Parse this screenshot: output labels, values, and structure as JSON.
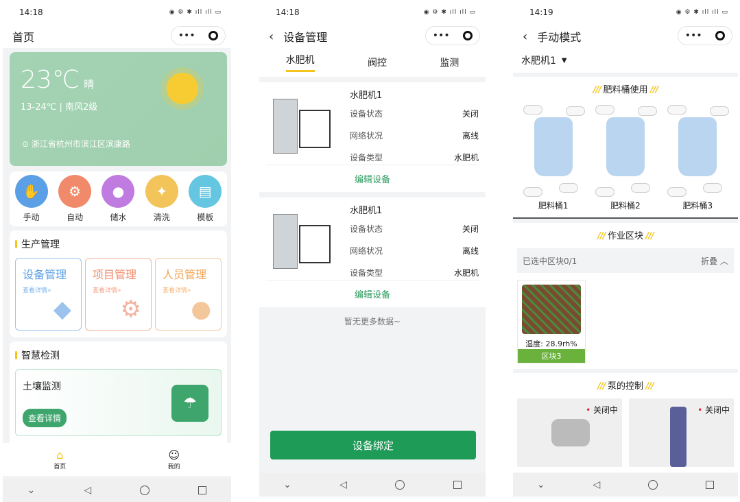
{
  "phone1": {
    "time": "14:18",
    "title": "首页",
    "temp": "23℃",
    "cond": "晴",
    "range": "13-24℃ | 南风2级",
    "location": "浙江省杭州市滨江区滨康路",
    "quick": [
      {
        "label": "手动",
        "color": "#5b9fe6"
      },
      {
        "label": "自动",
        "color": "#f08a6a"
      },
      {
        "label": "储水",
        "color": "#c07be0"
      },
      {
        "label": "清洗",
        "color": "#f2c45a"
      },
      {
        "label": "模板",
        "color": "#64c6e0"
      }
    ],
    "prod_title": "生产管理",
    "modules": [
      {
        "label": "设备管理",
        "sub": "查看详情»",
        "color": "#5b9fe6"
      },
      {
        "label": "项目管理",
        "sub": "查看详情»",
        "color": "#f08a6a"
      },
      {
        "label": "人员管理",
        "sub": "查看详情»",
        "color": "#f2a253"
      }
    ],
    "smart_title": "智慧检测",
    "soil": "土壤监测",
    "soil_btn": "查看详情",
    "tab_home": "首页",
    "tab_me": "我的"
  },
  "phone2": {
    "time": "14:18",
    "title": "设备管理",
    "tabs": [
      "水肥机",
      "阀控",
      "监测"
    ],
    "devices": [
      {
        "name": "水肥机1",
        "rows": [
          [
            "设备状态",
            "关闭"
          ],
          [
            "网络状况",
            "离线"
          ],
          [
            "设备类型",
            "水肥机"
          ]
        ],
        "edit": "编辑设备"
      },
      {
        "name": "水肥机1",
        "rows": [
          [
            "设备状态",
            "关闭"
          ],
          [
            "网络状况",
            "离线"
          ],
          [
            "设备类型",
            "水肥机"
          ]
        ],
        "edit": "编辑设备"
      }
    ],
    "nomore": "暂无更多数据~",
    "bind": "设备绑定"
  },
  "phone3": {
    "time": "14:19",
    "title": "手动模式",
    "selector": "水肥机1",
    "tank_title": "肥料桶使用",
    "tanks": [
      "肥料桶1",
      "肥料桶2",
      "肥料桶3"
    ],
    "zone_title": "作业区块",
    "zone_sel": "已选中区块0/1",
    "fold": "折叠",
    "block_humidity": "湿度: 28.9rh%",
    "block_name": "区块3",
    "pump_title": "泵的控制",
    "pumps": [
      "关闭中",
      "关闭中"
    ]
  }
}
